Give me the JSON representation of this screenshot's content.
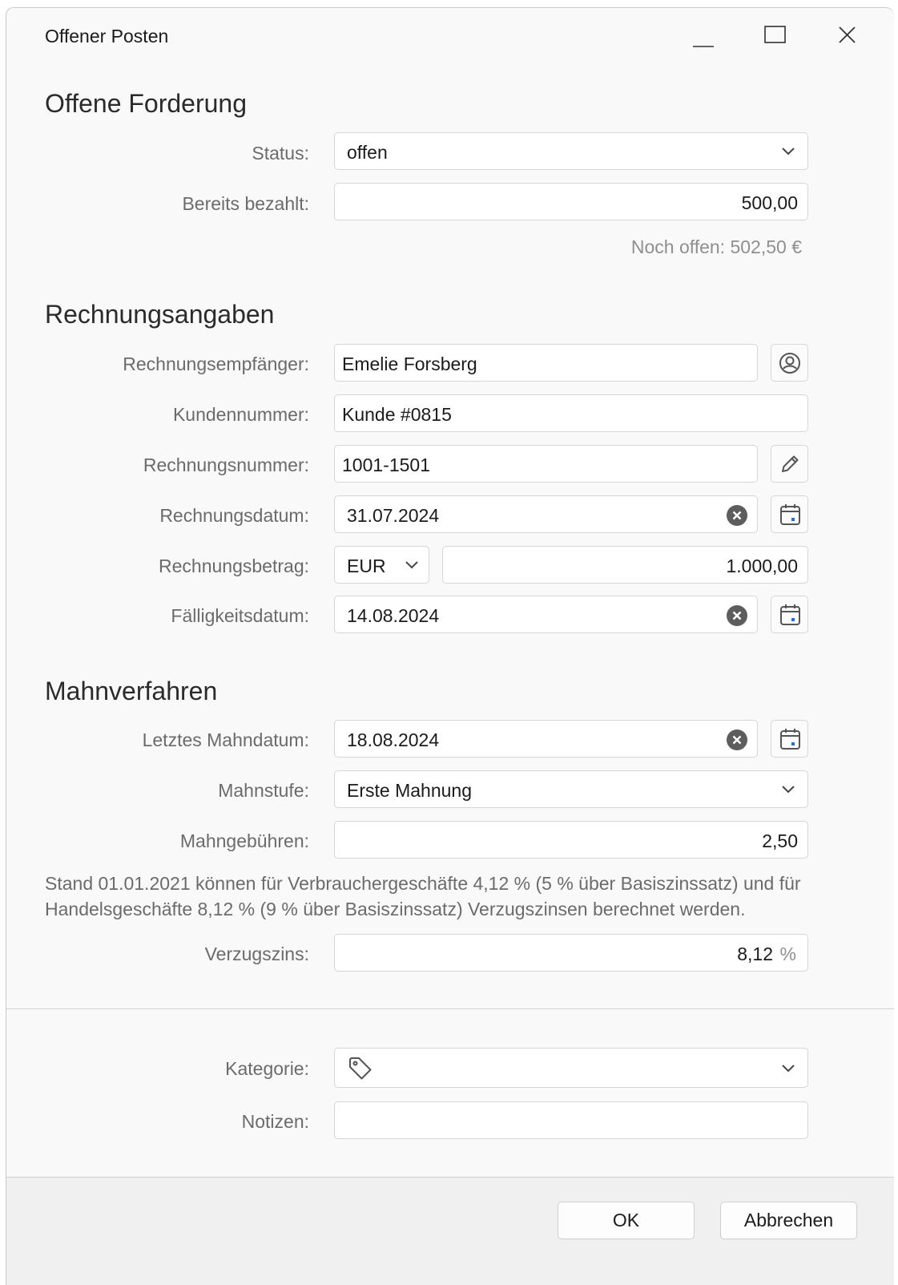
{
  "window": {
    "title": "Offener Posten"
  },
  "forderung": {
    "heading": "Offene Forderung",
    "status_label": "Status:",
    "status_value": "offen",
    "paid_label": "Bereits bezahlt:",
    "paid_value": "500,00",
    "remaining_hint": "Noch offen: 502,50 €"
  },
  "rechnung": {
    "heading": "Rechnungsangaben",
    "recipient_label": "Rechnungsempfänger:",
    "recipient_value": "Emelie Forsberg",
    "customer_label": "Kundennummer:",
    "customer_value": "Kunde #0815",
    "number_label": "Rechnungsnummer:",
    "number_value": "1001-1501",
    "date_label": "Rechnungsdatum:",
    "date_value": "31.07.2024",
    "amount_label": "Rechnungsbetrag:",
    "currency_value": "EUR",
    "amount_value": "1.000,00",
    "due_label": "Fälligkeitsdatum:",
    "due_value": "14.08.2024"
  },
  "mahn": {
    "heading": "Mahnverfahren",
    "last_date_label": "Letztes Mahndatum:",
    "last_date_value": "18.08.2024",
    "level_label": "Mahnstufe:",
    "level_value": "Erste Mahnung",
    "fees_label": "Mahngebühren:",
    "fees_value": "2,50",
    "info_text": "Stand 01.01.2021 können für Verbrauchergeschäfte 4,12 % (5 % über Basiszinssatz) und für Handelsgeschäfte 8,12 % (9 % über Basiszinssatz) Verzugszinsen berechnet werden.",
    "interest_label": "Verzugszins:",
    "interest_value": "8,12",
    "interest_unit": "%"
  },
  "extra": {
    "category_label": "Kategorie:",
    "category_value": "",
    "notes_label": "Notizen:",
    "notes_value": ""
  },
  "footer": {
    "ok_label": "OK",
    "cancel_label": "Abbrechen"
  },
  "icons": {
    "minimize": "minimize-icon",
    "maximize": "maximize-icon",
    "close": "close-icon",
    "dropdown": "chevron-down-icon",
    "contact": "contact-icon",
    "edit": "pencil-icon",
    "clear": "clear-icon",
    "calendar": "calendar-icon",
    "tag": "tag-icon"
  },
  "colors": {
    "window_bg": "#f9f9f9",
    "footer_bg": "#f0f0f0",
    "label": "#6b6b6b",
    "icon": "#5a5a5a"
  }
}
